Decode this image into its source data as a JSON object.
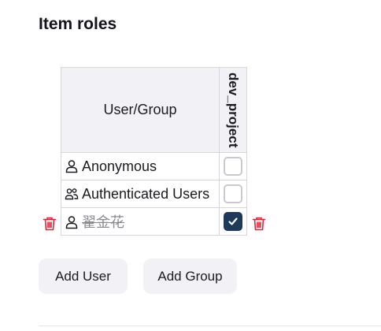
{
  "section": {
    "title": "Item roles"
  },
  "table": {
    "header_label": "User/Group",
    "columns": [
      "dev_project"
    ],
    "rows": [
      {
        "name": "Anonymous",
        "icon": "user-icon",
        "checked": false,
        "removed": false
      },
      {
        "name": "Authenticated Users",
        "icon": "group-icon",
        "checked": false,
        "removed": false
      },
      {
        "name": "翟金花",
        "icon": "user-icon",
        "checked": true,
        "removed": true
      }
    ]
  },
  "actions": {
    "add_user": "Add User",
    "add_group": "Add Group"
  },
  "colors": {
    "accent": "#1d3a5c",
    "danger": "#e0243c",
    "header_bg": "#f2f2f6"
  }
}
